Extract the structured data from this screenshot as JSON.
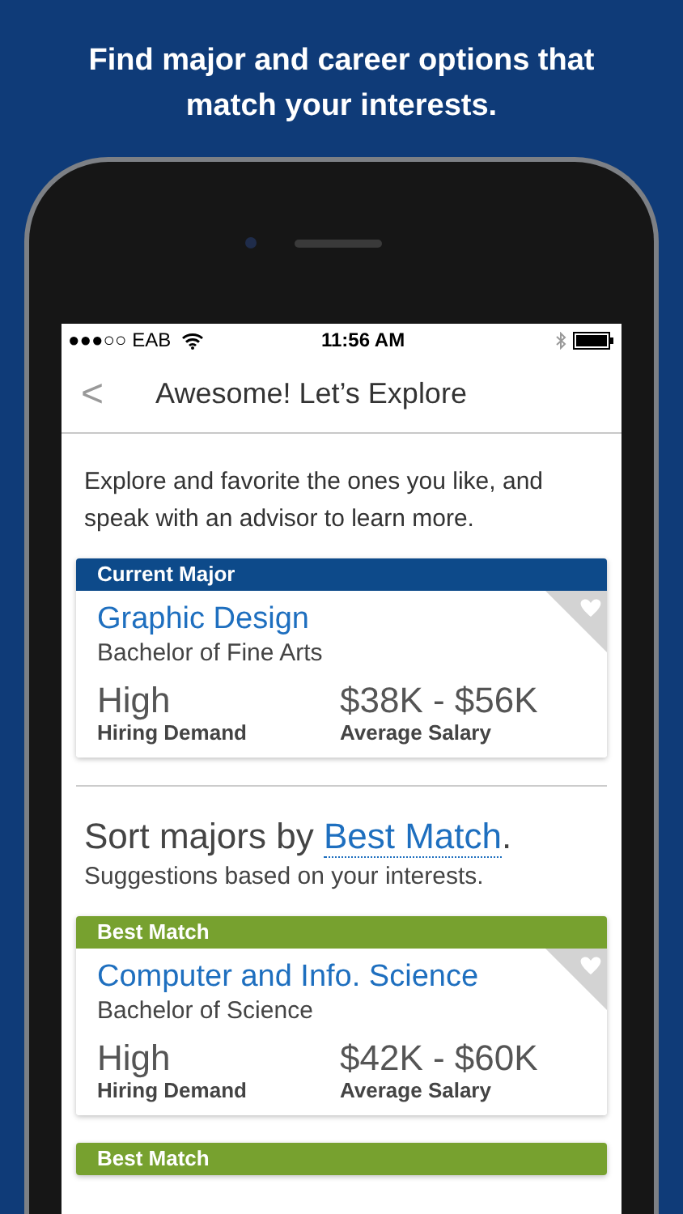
{
  "headline": "Find major and career options that match your interests.",
  "status_bar": {
    "carrier": "●●●○○ EAB",
    "time": "11:56 AM"
  },
  "nav": {
    "back": "<",
    "title": "Awesome! Let’s Explore"
  },
  "intro": "Explore and favorite the ones you like, and speak with an advisor to learn more.",
  "sections": [
    {
      "kind": "cards",
      "cards": [
        {
          "label": "Current Major",
          "color": "#0d4a8a",
          "name": "Graphic Design",
          "degree": "Bachelor of Fine Arts",
          "demand": "High",
          "demand_label": "Hiring Demand",
          "salary": "$38K - $56K",
          "salary_label": "Average Salary"
        }
      ]
    },
    {
      "kind": "sort",
      "prefix": "Sort majors by ",
      "link": "Best Match",
      "suffix": ".",
      "note": "Suggestions based on your interests."
    },
    {
      "kind": "cards",
      "cards": [
        {
          "label": "Best Match",
          "color": "#77a12f",
          "name": "Computer and Info. Science",
          "degree": "Bachelor of Science",
          "demand": "High",
          "demand_label": "Hiring Demand",
          "salary": "$42K - $60K",
          "salary_label": "Average Salary"
        },
        {
          "label": "Best Match",
          "color": "#77a12f"
        }
      ]
    }
  ]
}
